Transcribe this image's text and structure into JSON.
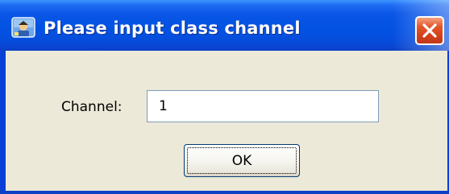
{
  "window": {
    "title": "Please input class channel",
    "app_icon": "app-icon",
    "close_icon": "close-icon",
    "colors": {
      "titlebar": "#0453e3",
      "client_background": "#ece9d8",
      "close_button": "#d3401a"
    }
  },
  "form": {
    "channel_label": "Channel:",
    "channel_value": "1",
    "ok_label": "OK"
  }
}
